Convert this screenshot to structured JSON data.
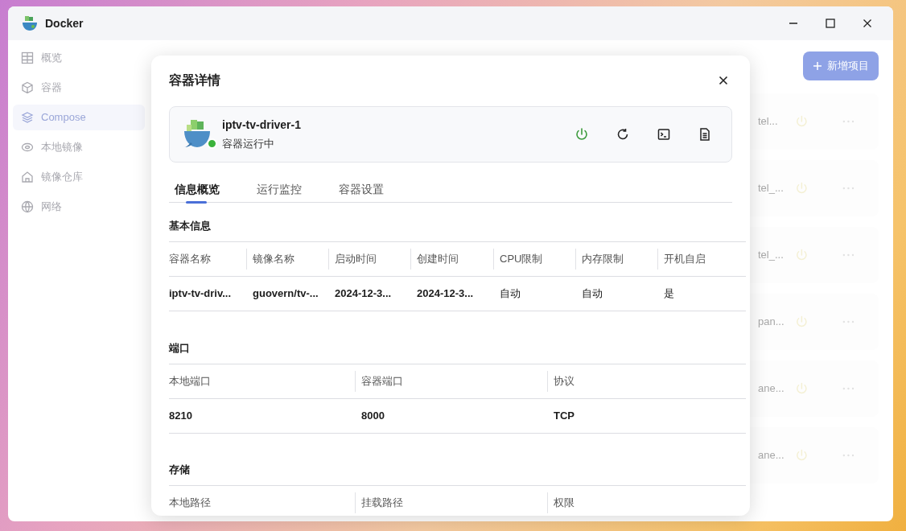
{
  "window": {
    "title": "Docker"
  },
  "sidebar": {
    "items": [
      {
        "label": "概览",
        "selected": false
      },
      {
        "label": "容器",
        "selected": false
      },
      {
        "label": "Compose",
        "selected": true
      },
      {
        "label": "本地镜像",
        "selected": false
      },
      {
        "label": "镜像仓库",
        "selected": false
      },
      {
        "label": "网络",
        "selected": false
      }
    ]
  },
  "new_button": {
    "label": "新增项目"
  },
  "background_rows": [
    {
      "name": "tel..."
    },
    {
      "name": "tel_..."
    },
    {
      "name": "tel_..."
    },
    {
      "name": "pan..."
    },
    {
      "name": "ane..."
    },
    {
      "name": "ane..."
    }
  ],
  "dialog": {
    "title": "容器详情",
    "container": {
      "name": "iptv-tv-driver-1",
      "status": "容器运行中",
      "running": true
    },
    "tabs": [
      {
        "label": "信息概览",
        "selected": true
      },
      {
        "label": "运行监控",
        "selected": false
      },
      {
        "label": "容器设置",
        "selected": false
      }
    ],
    "sections": [
      {
        "title": "基本信息",
        "columns": [
          "容器名称",
          "镜像名称",
          "启动时间",
          "创建时间",
          "CPU限制",
          "内存限制",
          "开机自启"
        ],
        "rows": [
          [
            "iptv-tv-driv...",
            "guovern/tv-...",
            "2024-12-3...",
            "2024-12-3...",
            "自动",
            "自动",
            "是"
          ]
        ]
      },
      {
        "title": "端口",
        "columns": [
          "本地端口",
          "容器端口",
          "协议"
        ],
        "rows": [
          [
            "8210",
            "8000",
            "TCP"
          ]
        ]
      },
      {
        "title": "存储",
        "columns": [
          "本地路径",
          "挂载路径",
          "权限"
        ]
      }
    ]
  }
}
